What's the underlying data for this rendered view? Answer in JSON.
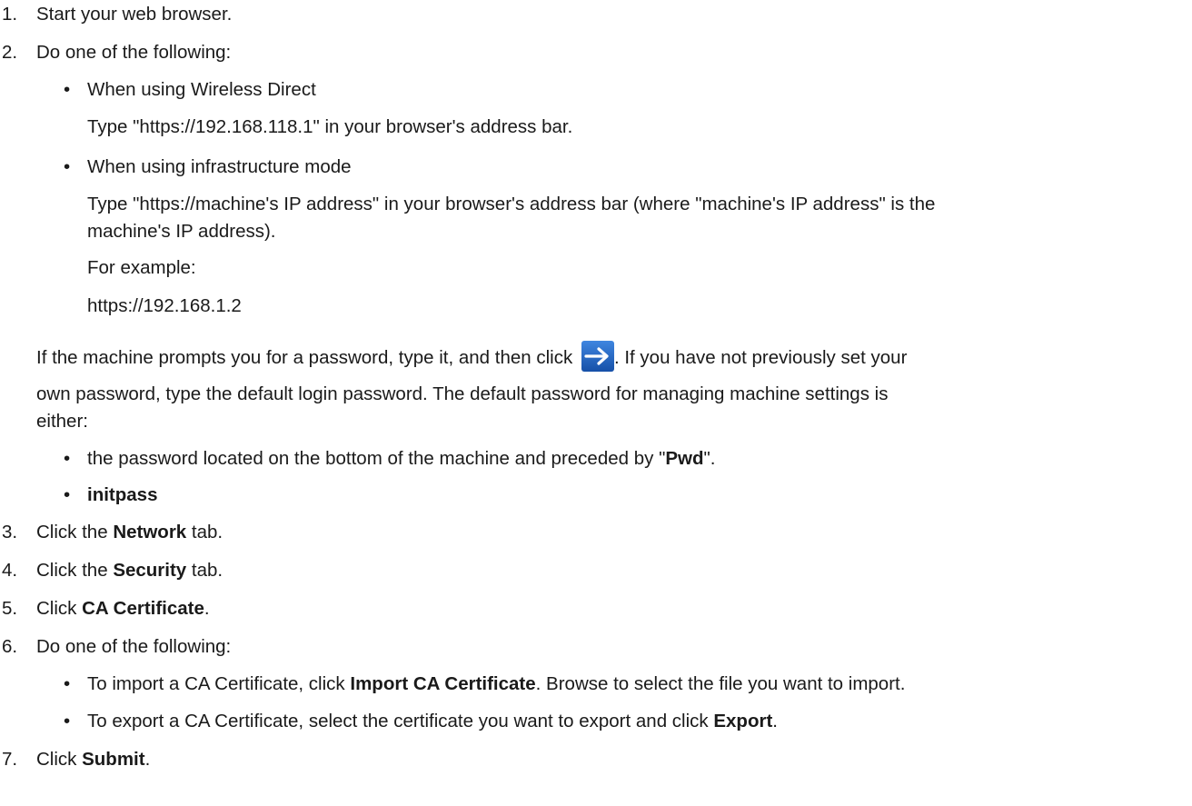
{
  "steps": [
    {
      "num": "1.",
      "text": "Start your web browser."
    },
    {
      "num": "2.",
      "text": "Do one of the following:"
    },
    {
      "num": "3.",
      "pre": "Click the ",
      "bold": "Network",
      "post": " tab."
    },
    {
      "num": "4.",
      "pre": "Click the ",
      "bold": "Security",
      "post": " tab."
    },
    {
      "num": "5.",
      "pre": "Click ",
      "bold": "CA Certificate",
      "post": "."
    },
    {
      "num": "6.",
      "text": "Do one of the following:"
    },
    {
      "num": "7.",
      "pre": "Click ",
      "bold": "Submit",
      "post": "."
    }
  ],
  "step2": {
    "opt1_title": "When using Wireless Direct",
    "opt1_desc": "Type \"https://192.168.118.1\" in your browser's address bar.",
    "opt2_title": "When using infrastructure mode",
    "opt2_desc_line1": "Type \"https://machine's IP address\" in your browser's address bar (where \"machine's IP address\" is the",
    "opt2_desc_line2": "machine's IP address).",
    "example_label": "For example:",
    "example_url": "https://192.168.1.2",
    "pw_line1_pre": "If the machine prompts you for a password, type it, and then click ",
    "pw_line1_post": ". If you have not previously set your",
    "pw_line2": "own password, type the default login password. The default password for managing machine settings is",
    "pw_line3": "either:",
    "pw_opt1_pre": "the password located on the bottom of the machine and preceded by \"",
    "pw_opt1_bold": "Pwd",
    "pw_opt1_post": "\".",
    "pw_opt2_bold": "initpass"
  },
  "step6": {
    "opt1_pre": "To import a CA Certificate, click ",
    "opt1_bold": "Import CA Certificate",
    "opt1_post": ". Browse to select the file you want to import.",
    "opt2_pre": "To export a CA Certificate, select the certificate you want to export and click ",
    "opt2_bold": "Export",
    "opt2_post": "."
  },
  "bullet_char": "•",
  "icons": {
    "go": "arrow-right-icon"
  },
  "colors": {
    "icon_bg": "#1f5fb8",
    "icon_fg": "#ffffff",
    "text": "#1a1a1a"
  }
}
